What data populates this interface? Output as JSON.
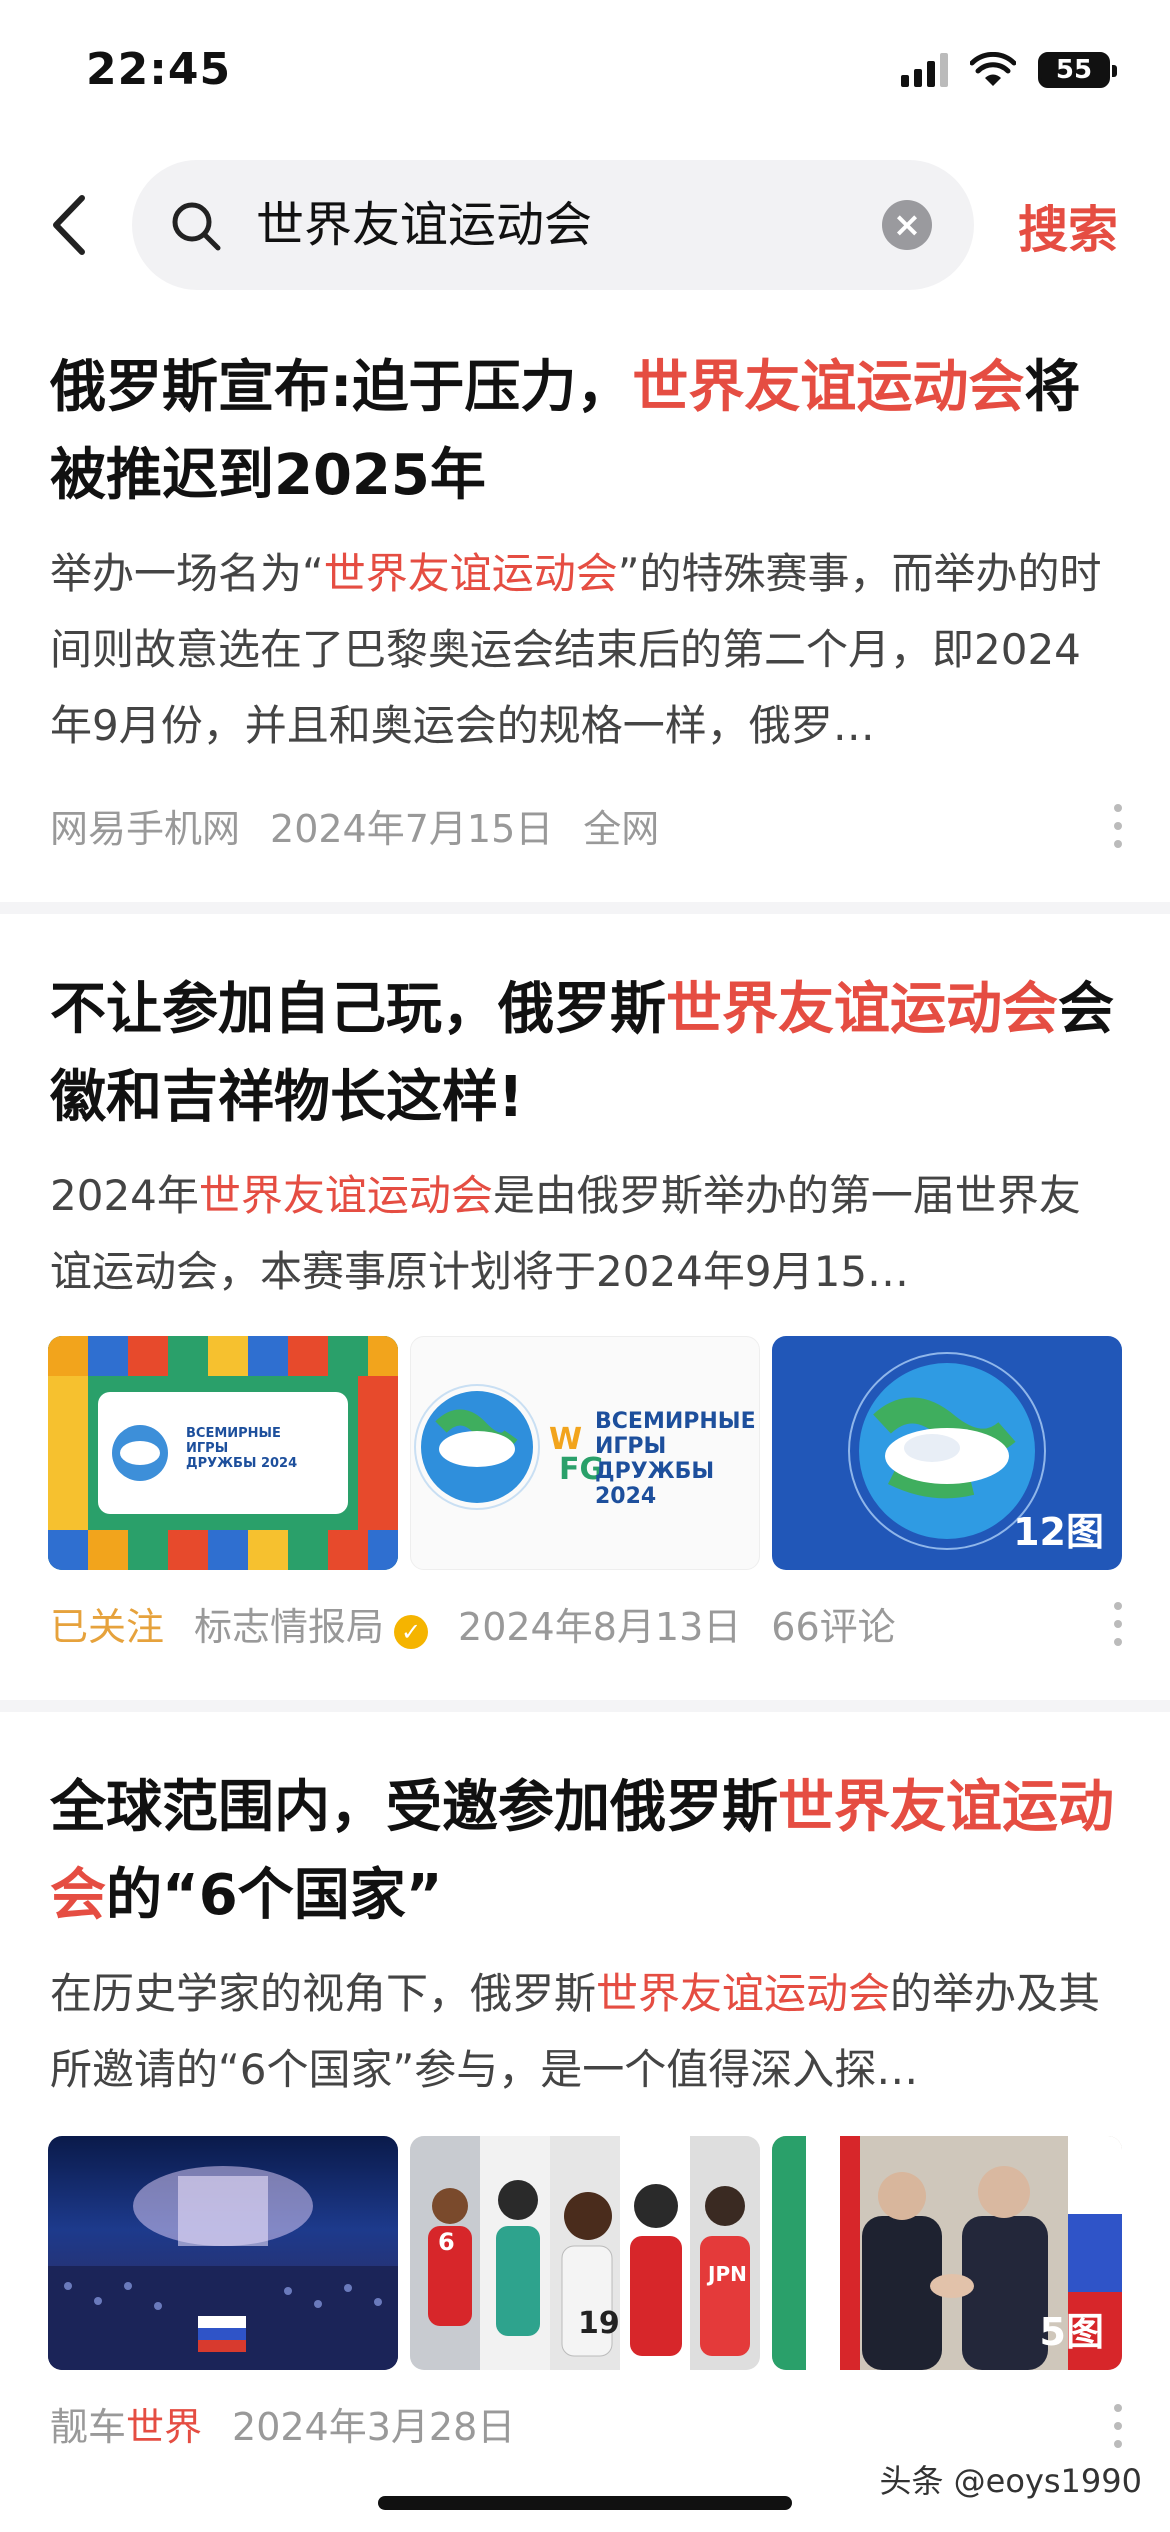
{
  "status_bar": {
    "time": "22:45",
    "battery": "55"
  },
  "search": {
    "query": "世界友谊运动会",
    "button_label": "搜索"
  },
  "articles": [
    {
      "title_parts": [
        "俄罗斯宣布:迫于压力，",
        "世界友谊运动会",
        "将被推迟到2025年"
      ],
      "summary_parts": [
        "举办一场名为“",
        "世界友谊运动会",
        "”的特殊赛事，而举办的时间则故意选在了巴黎奥运会结束后的第二个月，即2024年9月份，并且和奥运会的规格一样，俄罗…"
      ],
      "source": "网易手机网",
      "date": "2024年7月15日",
      "extra": "全网"
    },
    {
      "title_parts": [
        "不让参加自己玩，俄罗斯",
        "世界友谊运动会",
        "会徽和吉祥物长这样!"
      ],
      "summary_parts": [
        "2024年",
        "世界友谊运动会",
        "是由俄罗斯举办的第一届世界友谊运动会，本赛事原计划将于2024年9月15…"
      ],
      "follow_status": "已关注",
      "source": "标志情报局",
      "date": "2024年8月13日",
      "comments": "66评论",
      "thumb_texts": {
        "logo_line1": "ВСЕМИРНЫЕ",
        "logo_line2": "ИГРЫ",
        "logo_line3": "ДРУЖБЫ",
        "logo_year": "2024",
        "count": "12图"
      }
    },
    {
      "title_parts": [
        "全球范围内，受邀参加俄罗斯",
        "世界友谊运动会",
        "的“6个国家”"
      ],
      "summary_parts": [
        "在历史学家的视角下，俄罗斯",
        "世界友谊运动会",
        "的举办及其所邀请的“6个国家”参与，是一个值得深入探…"
      ],
      "source_parts": [
        "靓车",
        "世界"
      ],
      "date": "2024年3月28日",
      "thumb_texts": {
        "count": "5图",
        "jersey1": "6",
        "jersey2": "19",
        "jersey3": "JPN"
      }
    }
  ],
  "watermark": "头条 @eoys1990",
  "colors": {
    "accent": "#e54d42",
    "followed": "#e6a23c",
    "meta": "#999999"
  }
}
